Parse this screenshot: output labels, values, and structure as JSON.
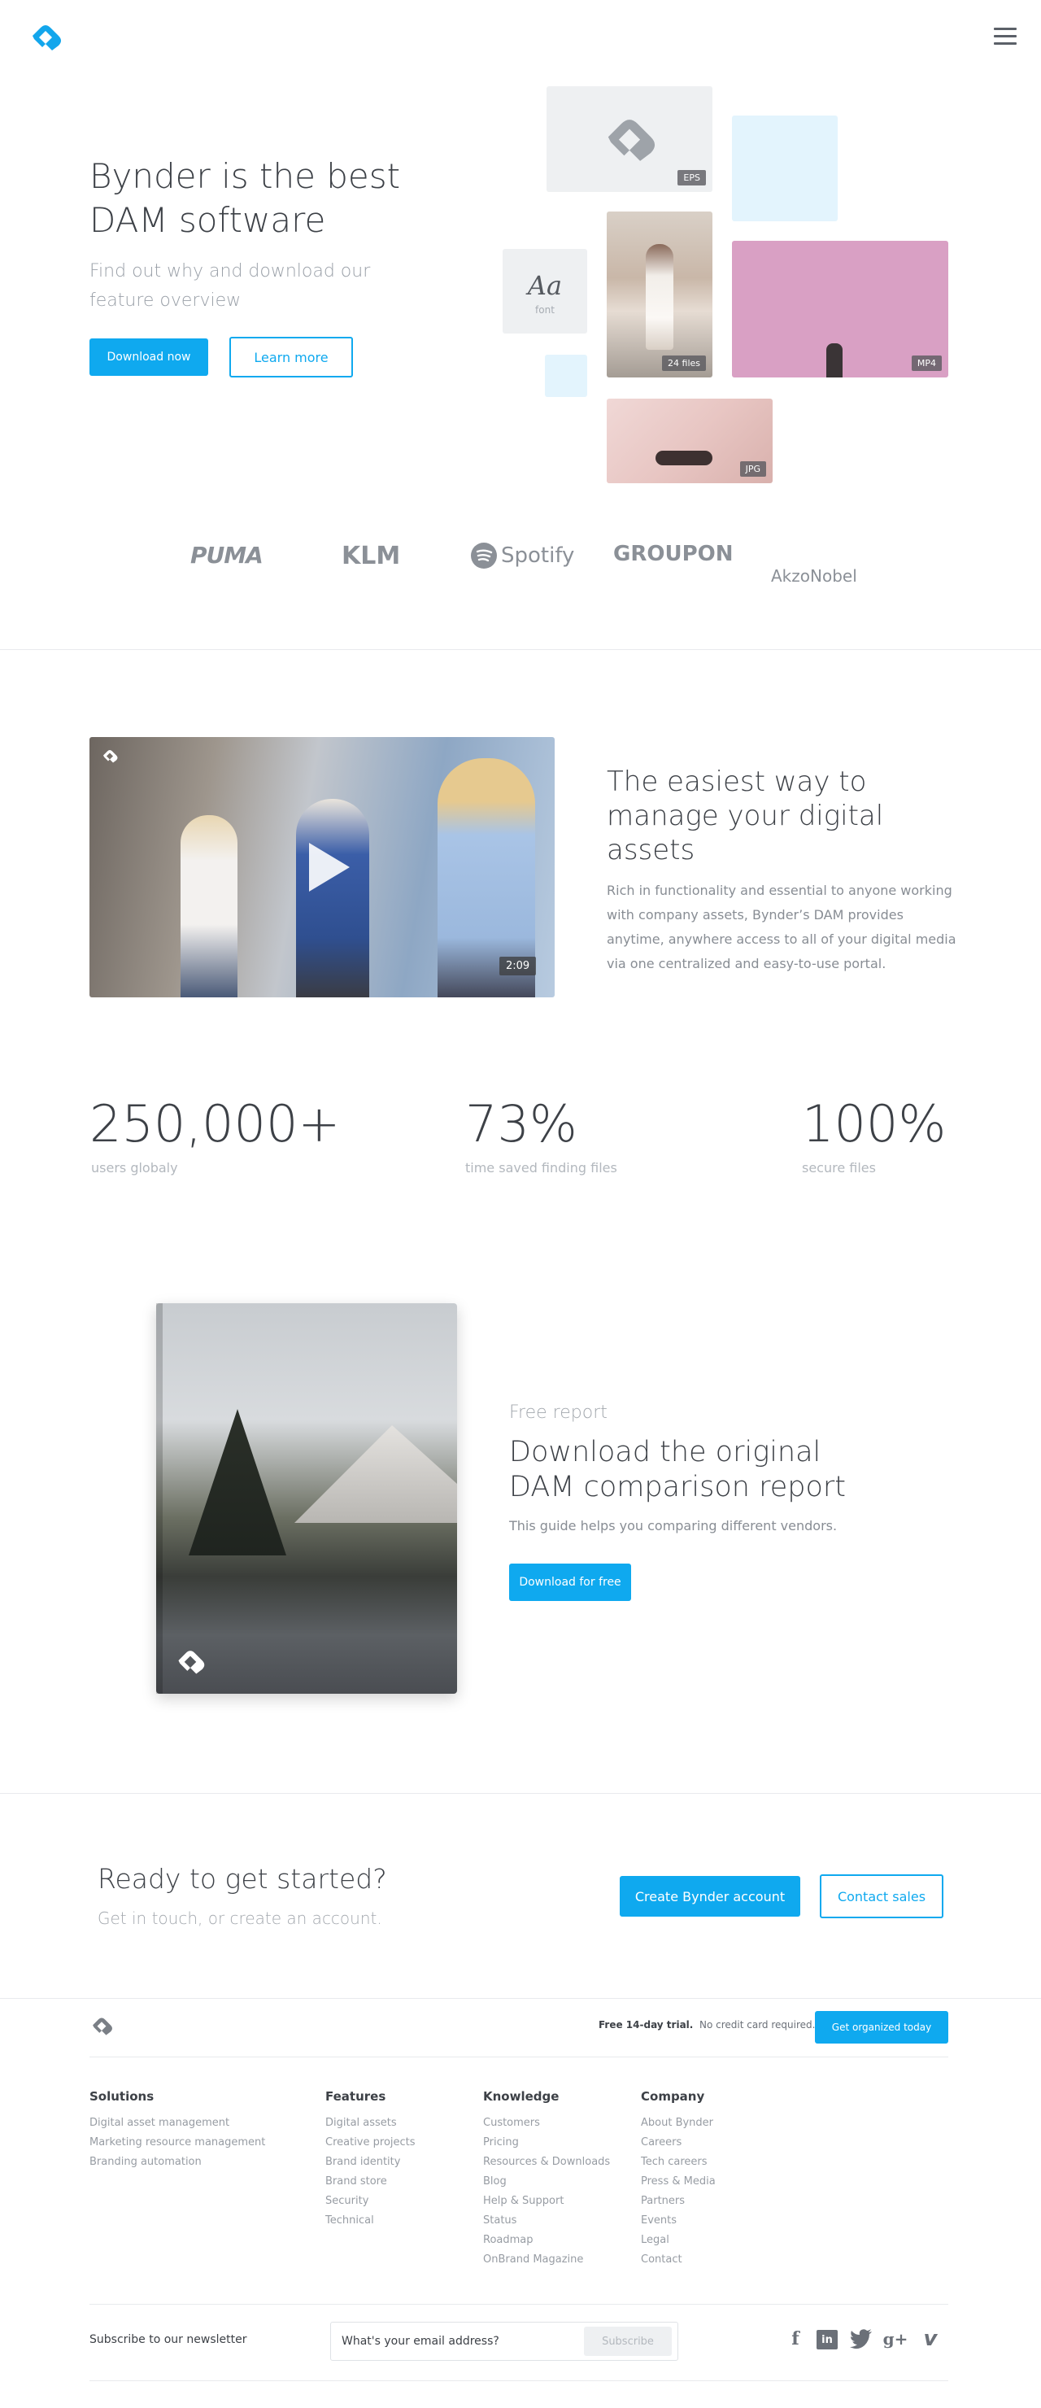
{
  "header": {
    "logo_icon": "bynder-logo-icon",
    "menu_icon": "hamburger-menu-icon"
  },
  "hero": {
    "title_line1": "Bynder is the best",
    "title_line2": "DAM software",
    "subtitle": "Find out why and download our feature overview",
    "download_label": "Download now",
    "learn_label": "Learn more",
    "tiles": {
      "eps": "EPS",
      "font_glyph": "Aa",
      "font_label": "font",
      "files": "24 files",
      "mp4": "MP4",
      "jpg": "JPG"
    }
  },
  "brands": [
    "PUMA",
    "KLM",
    "Spotify",
    "GROUPON",
    "AkzoNobel"
  ],
  "video_section": {
    "duration": "2:09",
    "title": "The easiest way to manage your digital assets",
    "body": "Rich in functionality and essential to anyone working with company assets, Bynder’s DAM provides anytime, anywhere access to all of your digital media via one centralized and easy-to-use portal."
  },
  "stats": [
    {
      "value": "250,000+",
      "label": "users globaly"
    },
    {
      "value": "73%",
      "label": "time saved finding files"
    },
    {
      "value": "100%",
      "label": "secure files"
    }
  ],
  "report": {
    "kicker": "Free report",
    "title_line1": "Download the original",
    "title_line2": "DAM comparison report",
    "subtitle": "This guide helps you comparing different vendors.",
    "button": "Download for free"
  },
  "cta": {
    "title": "Ready to get started?",
    "subtitle": "Get in touch, or create an account.",
    "create": "Create Bynder account",
    "contact": "Contact sales"
  },
  "footer": {
    "trial_bold": "Free 14-day trial.",
    "trial_rest": "No credit card required.",
    "trial_button": "Get organized today",
    "columns": [
      {
        "title": "Solutions",
        "links": [
          "Digital asset management",
          "Marketing resource management",
          "Branding automation"
        ]
      },
      {
        "title": "Features",
        "links": [
          "Digital assets",
          "Creative projects",
          "Brand identity",
          "Brand store",
          "Security",
          "Technical"
        ]
      },
      {
        "title": "Knowledge",
        "links": [
          "Customers",
          "Pricing",
          "Resources & Downloads",
          "Blog",
          "Help & Support",
          "Status",
          "Roadmap",
          "OnBrand Magazine"
        ]
      },
      {
        "title": "Company",
        "links": [
          "About Bynder",
          "Careers",
          "Tech careers",
          "Press & Media",
          "Partners",
          "Events",
          "Legal",
          "Contact"
        ]
      }
    ],
    "newsletter_label": "Subscribe to our newsletter",
    "newsletter_placeholder": "What's your email address?",
    "subscribe": "Subscribe",
    "social": {
      "facebook": "f",
      "linkedin": "in",
      "google": "g+",
      "vimeo": "v"
    }
  }
}
